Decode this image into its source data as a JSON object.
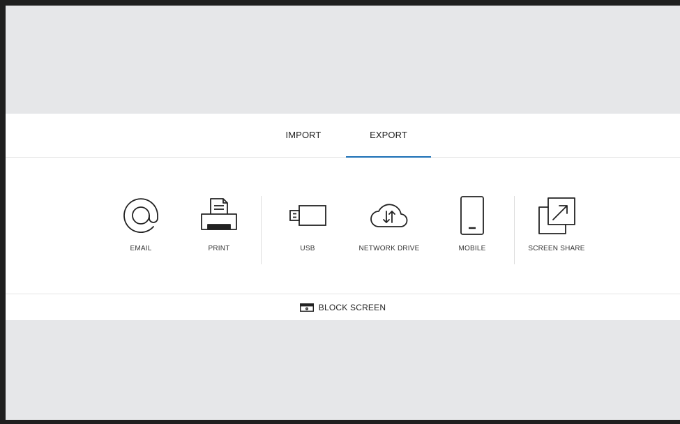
{
  "tabs": [
    {
      "label": "IMPORT",
      "active": false
    },
    {
      "label": "EXPORT",
      "active": true
    }
  ],
  "accent_color": "#1a6fb5",
  "items": [
    {
      "label": "EMAIL",
      "icon": "at-sign-icon"
    },
    {
      "label": "PRINT",
      "icon": "printer-icon"
    },
    {
      "label": "USB",
      "icon": "usb-drive-icon"
    },
    {
      "label": "NETWORK DRIVE",
      "icon": "cloud-transfer-icon"
    },
    {
      "label": "MOBILE",
      "icon": "mobile-phone-icon"
    },
    {
      "label": "SCREEN SHARE",
      "icon": "screen-share-icon"
    }
  ],
  "block_screen": {
    "label": "BLOCK SCREEN",
    "icon": "block-screen-icon"
  }
}
